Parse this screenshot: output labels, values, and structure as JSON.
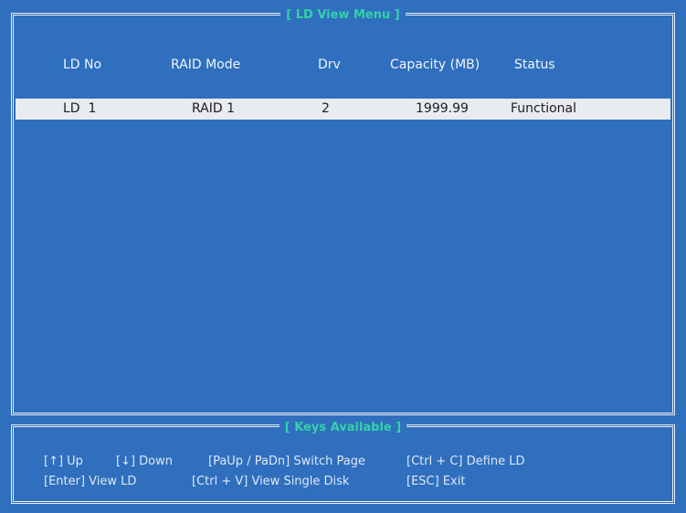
{
  "main_panel": {
    "title": "[ LD View Menu ]",
    "columns": [
      "LD No",
      "RAID Mode",
      "Drv",
      "Capacity (MB)",
      "Status"
    ],
    "rows": [
      {
        "ld_no": "LD  1",
        "raid_mode": "RAID 1",
        "drv": "2",
        "capacity": "1999.99",
        "status": "Functional"
      }
    ]
  },
  "keys_panel": {
    "title": "[ Keys Available ]",
    "line1": [
      "[↑] Up",
      "[↓] Down",
      "[PaUp / PaDn] Switch Page",
      "[Ctrl + C] Define LD"
    ],
    "line2": [
      "[Enter] View LD",
      "[Ctrl + V] View Single Disk",
      "[ESC] Exit"
    ]
  },
  "colors": {
    "background": "#2f6fbe",
    "title_accent": "#33d2a8",
    "selected_row": "#e8ebef",
    "text": "#f0f4fa"
  }
}
